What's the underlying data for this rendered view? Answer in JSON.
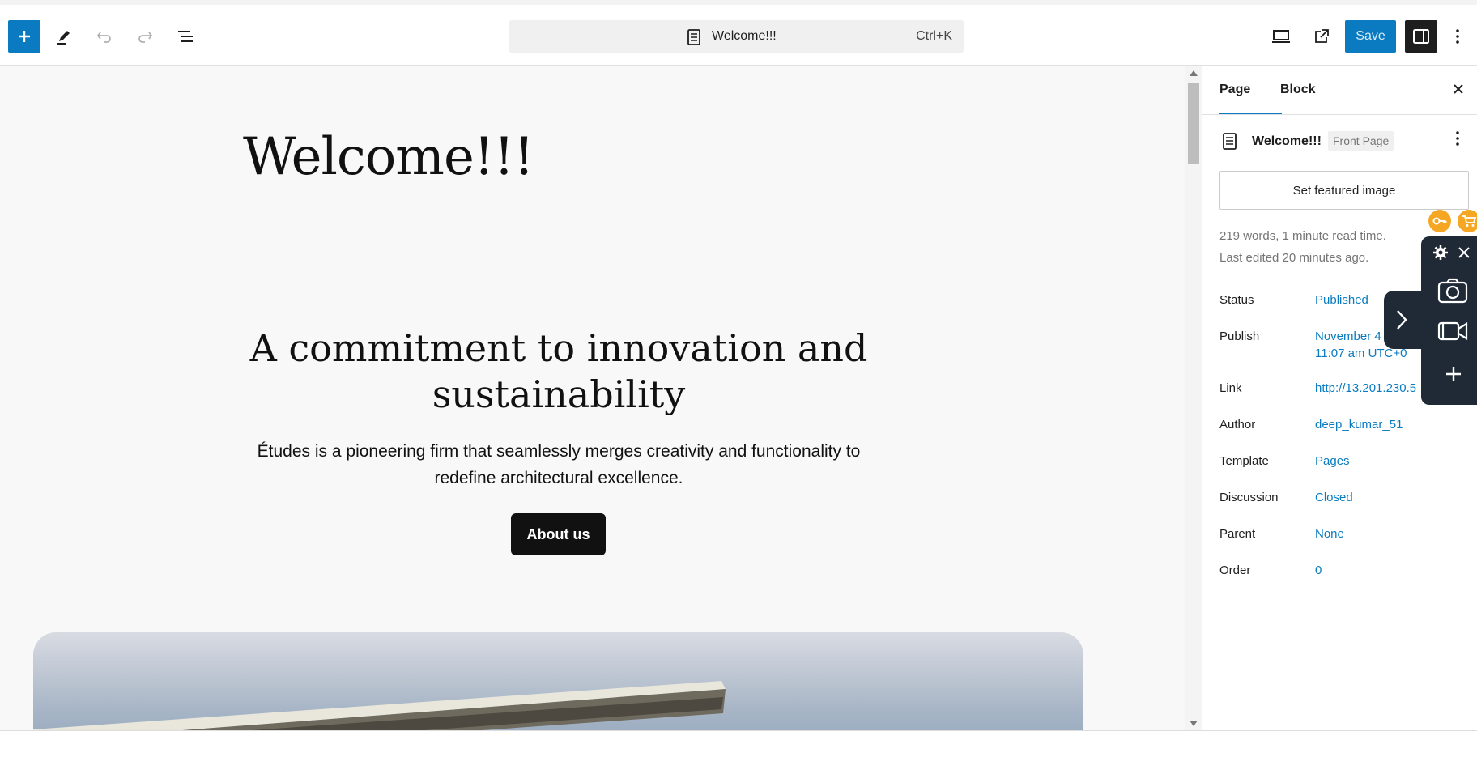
{
  "toolbar": {
    "add_label": "Add block",
    "doc_title": "Welcome!!!",
    "shortcut": "Ctrl+K",
    "save_label": "Save"
  },
  "canvas": {
    "page_heading": "Welcome!!!",
    "section_heading": "A commitment to innovation and sustainability",
    "description": "Études is a pioneering firm that seamlessly merges creativity and functionality to redefine architectural excellence.",
    "about_button": "About us"
  },
  "sidebar": {
    "tabs": [
      "Page",
      "Block"
    ],
    "doc_title": "Welcome!!!",
    "doc_badge": "Front Page",
    "featured_button": "Set featured image",
    "meta_words": "219 words, 1 minute read time.",
    "meta_edited": "Last edited 20 minutes ago.",
    "rows": [
      {
        "label": "Status",
        "value": "Published"
      },
      {
        "label": "Publish",
        "value": "November 4",
        "value2": "11:07 am UTC+0"
      },
      {
        "label": "Link",
        "value": "http://13.201.230.5"
      },
      {
        "label": "Author",
        "value": "deep_kumar_51"
      },
      {
        "label": "Template",
        "value": "Pages"
      },
      {
        "label": "Discussion",
        "value": "Closed"
      },
      {
        "label": "Parent",
        "value": "None"
      },
      {
        "label": "Order",
        "value": "0"
      }
    ]
  },
  "colors": {
    "accent": "#0a7bc0",
    "dark": "#1e1e1e",
    "overlay": "#1f2a36",
    "orange": "#f5a623"
  },
  "icons": [
    "plus-icon",
    "pen-icon",
    "undo-icon",
    "redo-icon",
    "list-view-icon",
    "document-icon",
    "desktop-preview-icon",
    "external-link-icon",
    "sidebar-icon",
    "more-vertical-icon",
    "close-icon",
    "key-icon",
    "cart-icon",
    "gear-icon",
    "camera-icon",
    "video-icon",
    "chevron-right-icon"
  ]
}
